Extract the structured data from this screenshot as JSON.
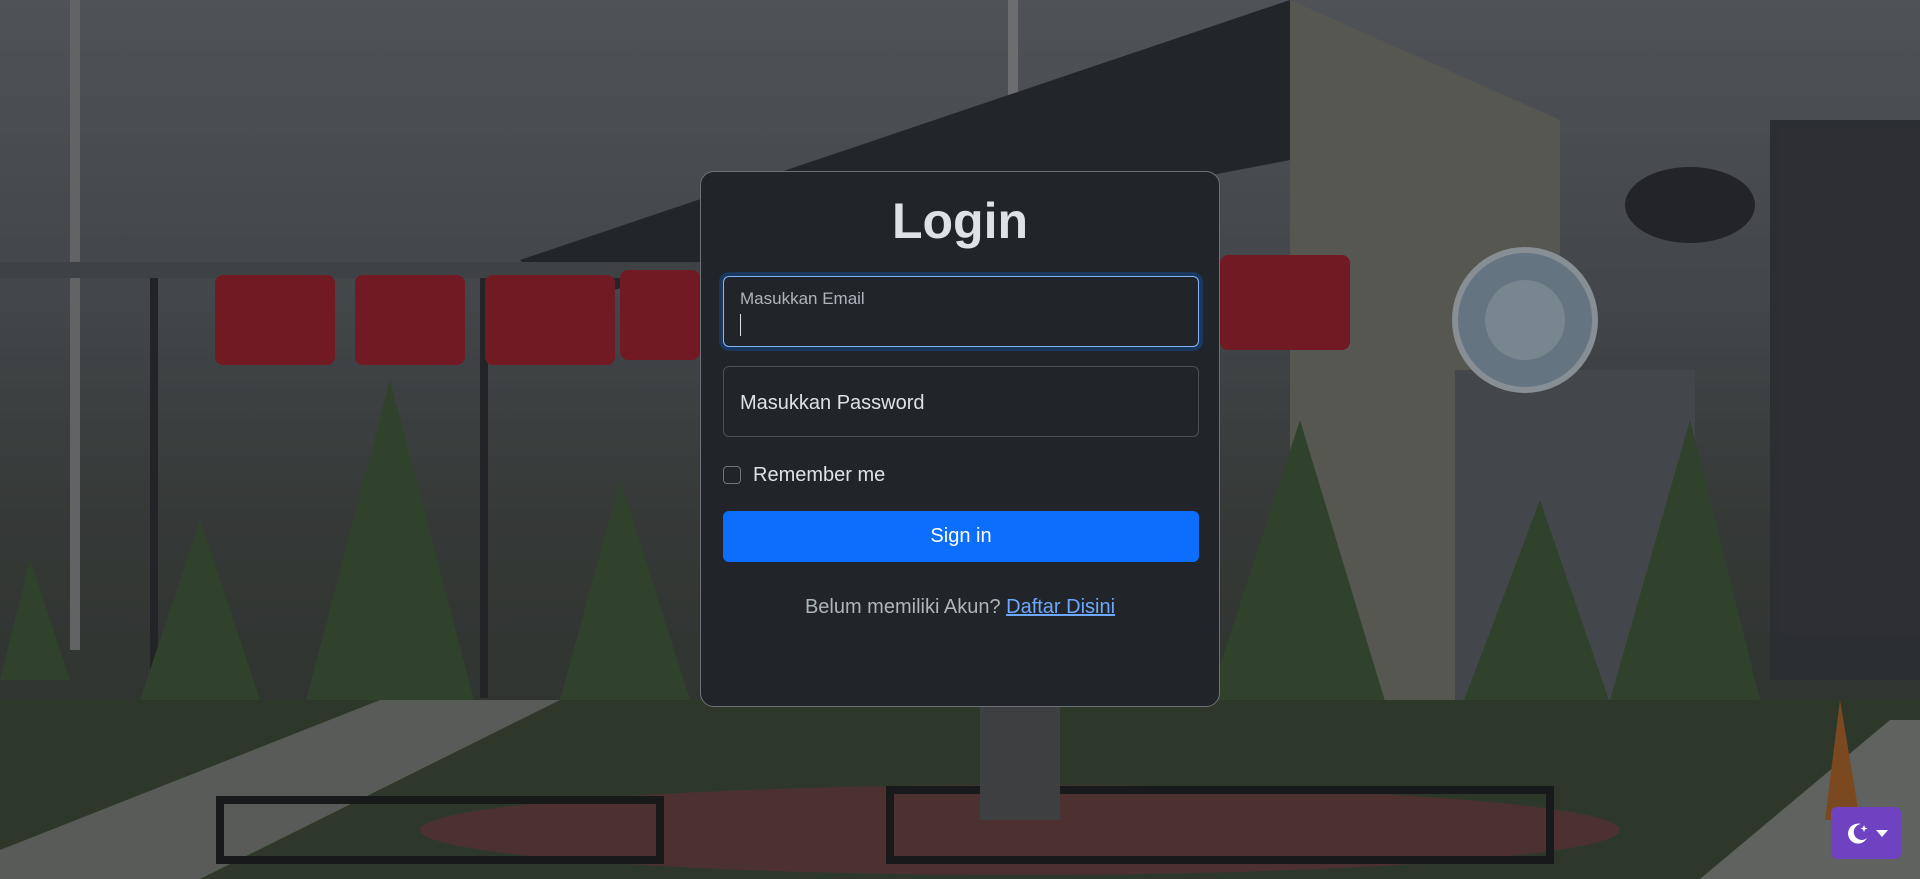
{
  "login": {
    "title": "Login",
    "email_label": "Masukkan Email",
    "password_placeholder": "Masukkan Password",
    "remember_label": "Remember me",
    "remember_checked": false,
    "signin_label": "Sign in",
    "register_prompt": "Belum memiliki Akun?",
    "register_link": "Daftar Disini"
  },
  "theme_toggle": {
    "icon": "moon-stars-icon",
    "dropdown_icon": "caret-down-icon"
  },
  "colors": {
    "card_background": "#212529",
    "primary": "#0d6efd",
    "link": "#6ea8fe",
    "theme_toggle": "#6f42c1"
  }
}
